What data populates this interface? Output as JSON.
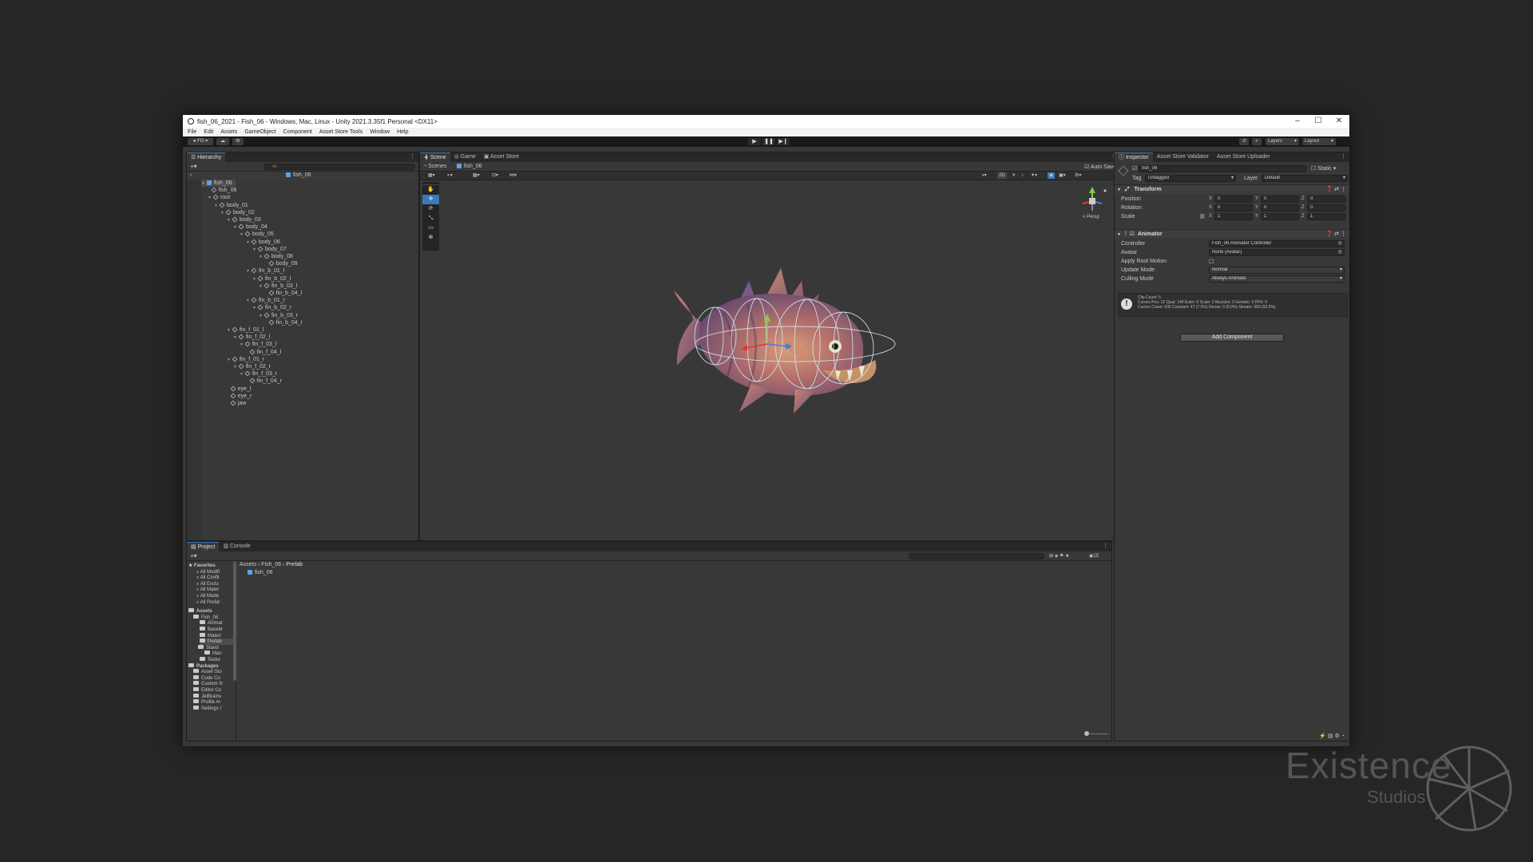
{
  "window": {
    "title": "fish_06_2021 - Fish_06 - Windows, Mac, Linux - Unity 2021.3.35f1 Personal <DX11>",
    "controls": [
      "–",
      "☐",
      "✕"
    ]
  },
  "menu": [
    "File",
    "Edit",
    "Assets",
    "GameObject",
    "Component",
    "Asset Store Tools",
    "Window",
    "Help"
  ],
  "toolbar": {
    "account": "FO",
    "layers_label": "Layers",
    "layout_label": "Layout"
  },
  "hierarchy": {
    "tab_label": "Hierarchy",
    "search_placeholder": "All",
    "breadcrumb": "fish_06",
    "items": [
      {
        "label": "fish_06",
        "depth": 0
      },
      {
        "label": "fish_06",
        "depth": 1
      },
      {
        "label": "root",
        "depth": 1
      },
      {
        "label": "body_01",
        "depth": 2
      },
      {
        "label": "body_02",
        "depth": 3
      },
      {
        "label": "body_03",
        "depth": 4
      },
      {
        "label": "body_04",
        "depth": 5
      },
      {
        "label": "body_05",
        "depth": 6
      },
      {
        "label": "body_06",
        "depth": 7
      },
      {
        "label": "body_07",
        "depth": 8
      },
      {
        "label": "body_08",
        "depth": 9
      },
      {
        "label": "body_09",
        "depth": 10
      },
      {
        "label": "fin_b_01_l",
        "depth": 7
      },
      {
        "label": "fin_b_02_l",
        "depth": 8
      },
      {
        "label": "fin_b_03_l",
        "depth": 9
      },
      {
        "label": "fin_b_04_l",
        "depth": 10
      },
      {
        "label": "fin_b_01_r",
        "depth": 7
      },
      {
        "label": "fin_b_02_r",
        "depth": 8
      },
      {
        "label": "fin_b_03_r",
        "depth": 9
      },
      {
        "label": "fin_b_04_r",
        "depth": 10
      },
      {
        "label": "fin_f_01_l",
        "depth": 4
      },
      {
        "label": "fin_f_02_l",
        "depth": 5
      },
      {
        "label": "fin_f_03_l",
        "depth": 6
      },
      {
        "label": "fin_f_04_l",
        "depth": 7
      },
      {
        "label": "fin_f_01_r",
        "depth": 4
      },
      {
        "label": "fin_f_02_r",
        "depth": 5
      },
      {
        "label": "fin_f_03_r",
        "depth": 6
      },
      {
        "label": "fin_f_04_r",
        "depth": 7
      },
      {
        "label": "eye_l",
        "depth": 4
      },
      {
        "label": "eye_r",
        "depth": 4
      },
      {
        "label": "jaw",
        "depth": 4
      }
    ]
  },
  "scene": {
    "tabs": [
      "Scene",
      "Game",
      "Asset Store"
    ],
    "breadcrumb_root": "Scenes",
    "breadcrumb_item": "fish_06",
    "auto_save": "Auto Save",
    "mode_2d": "2D",
    "persp_label": "< Persp"
  },
  "inspector": {
    "tabs": [
      "Inspector",
      "Asset Store Validator",
      "Asset Store Uploader"
    ],
    "object_name": "fish_06",
    "static_label": "Static",
    "tag_label": "Tag",
    "tag_value": "Untagged",
    "layer_label": "Layer",
    "layer_value": "Default",
    "transform": {
      "title": "Transform",
      "rows": [
        {
          "label": "Position",
          "x": "0",
          "y": "0",
          "z": "0"
        },
        {
          "label": "Rotation",
          "x": "0",
          "y": "0",
          "z": "0"
        },
        {
          "label": "Scale",
          "x": "1",
          "y": "1",
          "z": "1"
        }
      ]
    },
    "animator": {
      "title": "Animator",
      "rows": [
        {
          "label": "Controller",
          "value": "Fish_06 Animator Controller"
        },
        {
          "label": "Avatar",
          "value": "None (Avatar)"
        },
        {
          "label": "Apply Root Motion",
          "value": ""
        },
        {
          "label": "Update Mode",
          "value": "Normal"
        },
        {
          "label": "Culling Mode",
          "value": "Always Animate"
        }
      ],
      "info_line1": "Clip Count: 5",
      "info_line2": "Curves Pos: 12 Quat: 144 Euler: 0 Scale: 0 Muscles: 0 Generic: 0 PPtr: 0",
      "info_line3": "Curves Count: 630 Constant: 47 (7.5%) Dense: 0 (0.0%) Stream: 583 (92.5%)"
    },
    "add_component": "Add Component"
  },
  "project": {
    "tabs": [
      "Project",
      "Console"
    ],
    "favorites_label": "Favorites",
    "favorites": [
      "All Modifi",
      "All Confli",
      "All Exclu",
      "All Mater",
      "All Mode",
      "All Prefat"
    ],
    "assets_label": "Assets",
    "assets_tree": [
      "Fish_06",
      "Animat",
      "BaseM",
      "Materi",
      "Prefab",
      "Stand",
      "Man",
      "Textur"
    ],
    "packages_label": "Packages",
    "packages": [
      "Asset Sto",
      "Code Co",
      "Custom N",
      "Editor Co",
      "JetBrains",
      "Profile Ar",
      "Settings I"
    ],
    "breadcrumb": [
      "Assets",
      "Fish_06",
      "Prefab"
    ],
    "files": [
      "fish_06"
    ],
    "hidden_count": "15"
  },
  "watermark": {
    "line1": "Existence",
    "line2": "Studios"
  },
  "colors": {
    "scene_bg": "#2a4766",
    "accent": "#3a79bb",
    "gizmo_x": "#e0392b",
    "gizmo_y": "#7fd241",
    "gizmo_z": "#3d7fe0"
  }
}
